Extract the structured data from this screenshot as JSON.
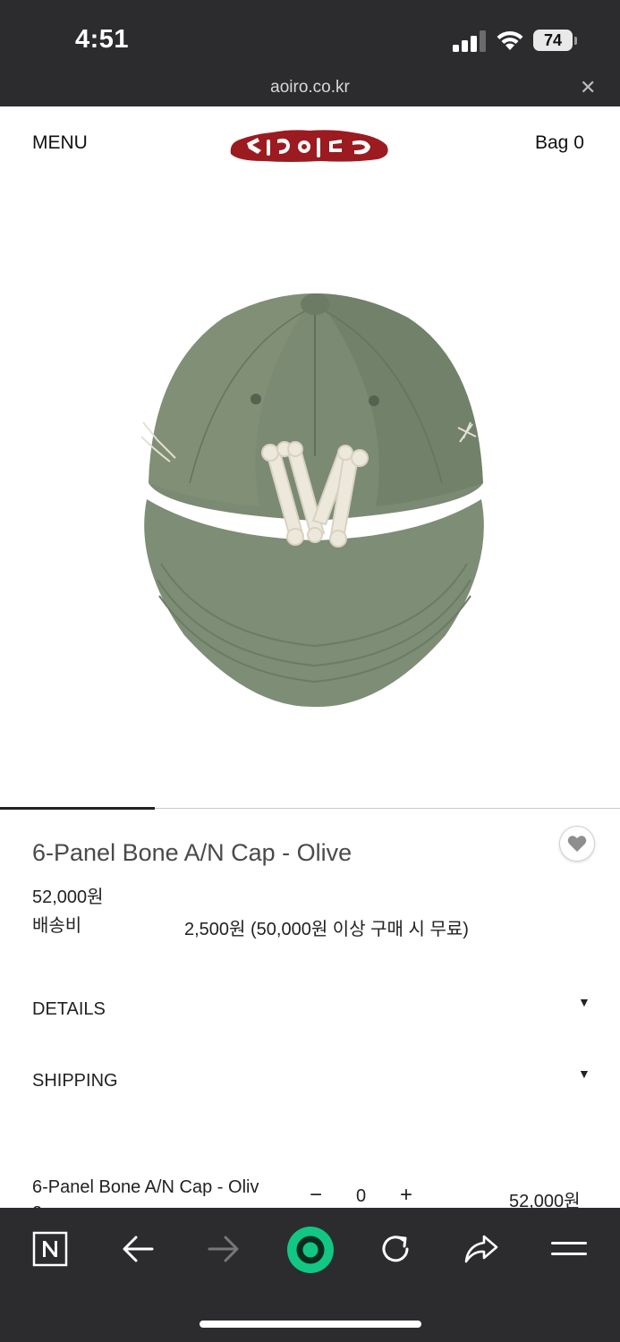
{
  "status_bar": {
    "time": "4:51",
    "battery": "74"
  },
  "browser": {
    "url": "aoiro.co.kr",
    "close_icon": "close-icon"
  },
  "header": {
    "menu_label": "MENU",
    "logo": "brand-logo",
    "bag_label": "Bag 0"
  },
  "gallery": {
    "progress_fraction": 0.25
  },
  "product": {
    "title": "6-Panel Bone A/N Cap - Olive",
    "price": "52,000원",
    "shipping_label": "배송비",
    "shipping_value": "2,500원 (50,000원 이상 구매 시 무료)"
  },
  "accordion": [
    {
      "label": "DETAILS",
      "icon": "triangle-down-icon"
    },
    {
      "label": "SHIPPING",
      "icon": "triangle-down-icon"
    }
  ],
  "option": {
    "name": "6-Panel Bone A/N Cap - Oliv",
    "name_overflow": "e",
    "minus": "−",
    "quantity": "0",
    "plus": "+",
    "price": "52,000원"
  },
  "toolbar": {
    "items": [
      "naver-n-icon",
      "back-arrow-icon",
      "forward-arrow-icon",
      "green-dot-icon",
      "reload-icon",
      "share-icon",
      "hamburger-menu-icon"
    ]
  },
  "colors": {
    "system_bar": "#2c2c2e",
    "logo_red": "#9b1b20",
    "cap_olive": "#7b8a72",
    "green_button": "#12c684"
  }
}
